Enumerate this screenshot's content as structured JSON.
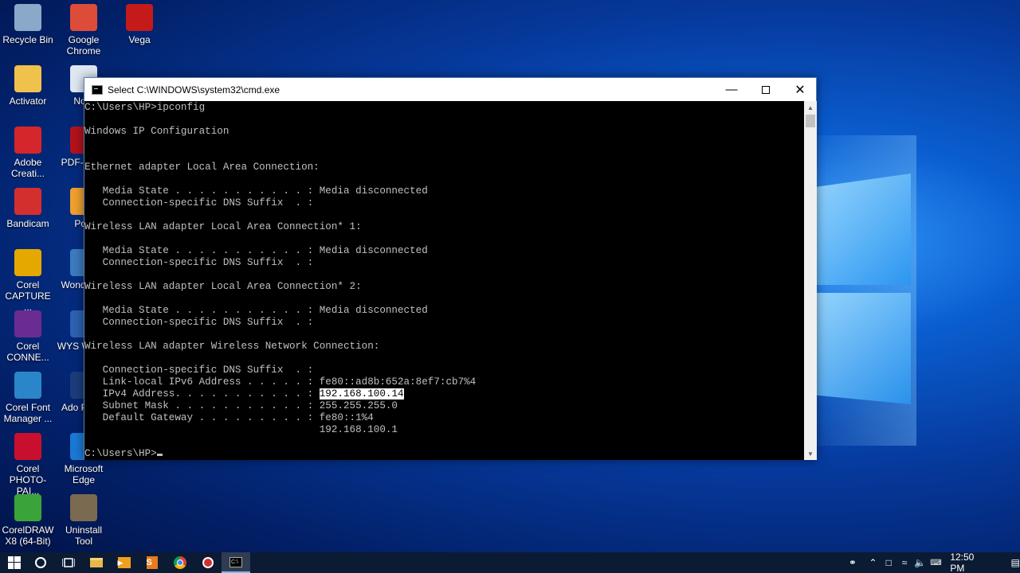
{
  "desktop": {
    "icons": [
      {
        "label": "Recycle Bin",
        "icon": "recycle-bin-icon",
        "color": "#8aa8c8"
      },
      {
        "label": "Google Chrome",
        "icon": "chrome-icon",
        "color": "#dd4b39"
      },
      {
        "label": "Vega",
        "icon": "vega-icon",
        "color": "#c41a1a"
      },
      {
        "label": "Activator",
        "icon": "folder-icon",
        "color": "#f0c14b"
      },
      {
        "label": "Note",
        "icon": "notepad-icon",
        "color": "#dfe8f2"
      },
      {
        "label": "Adobe Creati...",
        "icon": "adobe-cc-icon",
        "color": "#d4262b"
      },
      {
        "label": "PDF-X Edi",
        "icon": "pdf-xchange-icon",
        "color": "#b3131b"
      },
      {
        "label": "Bandicam",
        "icon": "bandicam-icon",
        "color": "#d32f2f"
      },
      {
        "label": "Pow",
        "icon": "power-icon",
        "color": "#f0a030"
      },
      {
        "label": "Corel CAPTURE ...",
        "icon": "corel-capture-icon",
        "color": "#e5a800"
      },
      {
        "label": "Wond Film",
        "icon": "wondershare-icon",
        "color": "#3b7bbf"
      },
      {
        "label": "Corel CONNE...",
        "icon": "corel-connect-icon",
        "color": "#6a2c91"
      },
      {
        "label": "WYS Web E",
        "icon": "wysiwyg-icon",
        "color": "#2c62b0"
      },
      {
        "label": "Corel Font Manager ...",
        "icon": "corel-font-icon",
        "color": "#2a86c8"
      },
      {
        "label": "Ado Photo",
        "icon": "photoshop-icon",
        "color": "#1c3d7a"
      },
      {
        "label": "Corel PHOTO-PAI...",
        "icon": "corel-photopaint-icon",
        "color": "#c8102e"
      },
      {
        "label": "Microsoft Edge",
        "icon": "edge-icon",
        "color": "#1b7ad6"
      },
      {
        "label": "CorelDRAW X8 (64-Bit)",
        "icon": "coreldraw-icon",
        "color": "#3aa43a"
      },
      {
        "label": "Uninstall Tool",
        "icon": "uninstall-tool-icon",
        "color": "#7a6a50"
      }
    ]
  },
  "cmd": {
    "title": "Select C:\\WINDOWS\\system32\\cmd.exe",
    "lines": [
      "C:\\Users\\HP>ipconfig",
      "",
      "Windows IP Configuration",
      "",
      "",
      "Ethernet adapter Local Area Connection:",
      "",
      "   Media State . . . . . . . . . . . : Media disconnected",
      "   Connection-specific DNS Suffix  . :",
      "",
      "Wireless LAN adapter Local Area Connection* 1:",
      "",
      "   Media State . . . . . . . . . . . : Media disconnected",
      "   Connection-specific DNS Suffix  . :",
      "",
      "Wireless LAN adapter Local Area Connection* 2:",
      "",
      "   Media State . . . . . . . . . . . : Media disconnected",
      "   Connection-specific DNS Suffix  . :",
      "",
      "Wireless LAN adapter Wireless Network Connection:",
      "",
      "   Connection-specific DNS Suffix  . :",
      "   Link-local IPv6 Address . . . . . : fe80::ad8b:652a:8ef7:cb7%4"
    ],
    "ipv4_label": "   IPv4 Address. . . . . . . . . . . : ",
    "ipv4_value": "192.168.100.14",
    "tail_lines": [
      "   Subnet Mask . . . . . . . . . . . : 255.255.255.0",
      "   Default Gateway . . . . . . . . . : fe80::1%4",
      "                                       192.168.100.1",
      ""
    ],
    "prompt": "C:\\Users\\HP>"
  },
  "taskbar": {
    "clock": "12:50 PM",
    "colors": {
      "background": "#0b1b33",
      "active_underline": "#7fb6ee"
    }
  }
}
